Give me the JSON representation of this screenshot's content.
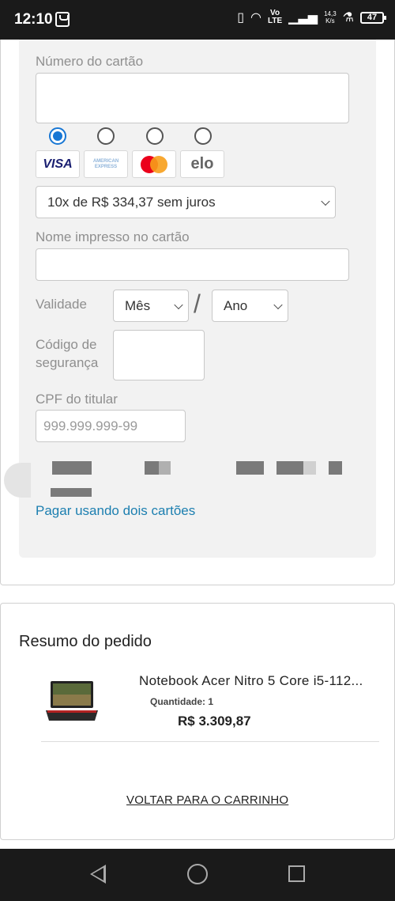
{
  "status_bar": {
    "time": "12:10",
    "network_top": "Vo",
    "network_bottom": "LTE",
    "speed_value": "14,3",
    "speed_unit": "K/s",
    "battery": "47"
  },
  "payment": {
    "card_number_label": "Número do cartão",
    "card_number_value": "",
    "brands": [
      {
        "icon": "visa-logo",
        "label": "VISA",
        "selected": true
      },
      {
        "icon": "american-express-logo",
        "label": "AMERICAN EXPRESS",
        "selected": false
      },
      {
        "icon": "mastercard-logo",
        "label": "",
        "selected": false
      },
      {
        "icon": "elo-logo",
        "label": "elo",
        "selected": false
      }
    ],
    "installments_selected": "10x de R$ 334,37 sem juros",
    "name_label": "Nome impresso no cartão",
    "name_value": "",
    "validity_label": "Validade",
    "month_selected": "Mês",
    "validity_separator": "/",
    "year_selected": "Ano",
    "security_label_line1": "Código de",
    "security_label_line2": "segurança",
    "cpf_label": "CPF do titular",
    "cpf_placeholder": "999.999.999-99",
    "two_cards_link": "Pagar usando dois cartões"
  },
  "summary": {
    "title": "Resumo do pedido",
    "product_name": "Notebook Acer Nitro 5 Core i5-112...",
    "quantity": "Quantidade: 1",
    "price": "R$ 3.309,87",
    "back_link": "VOLTAR PARA O CARRINHO"
  },
  "colors": {
    "accent": "#1877d4",
    "link": "#1c7fb0",
    "panel_bg": "#f2f2f2"
  }
}
